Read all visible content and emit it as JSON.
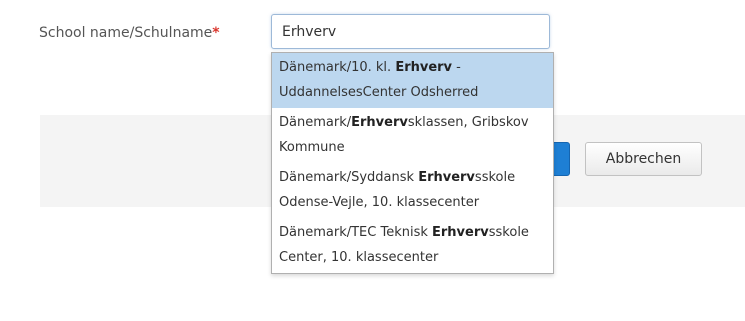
{
  "form": {
    "school_label": "School name/Schulname",
    "required_marker": "*",
    "school_input_value": "Erhverv"
  },
  "suggestions": [
    {
      "pre": "Dänemark/10. kl. ",
      "match": "Erhverv",
      "post": " - UddannelsesCenter Odsherred",
      "active": true
    },
    {
      "pre": "Dänemark/",
      "match": "Erhverv",
      "post": "sklassen, Gribskov Kommune",
      "active": false
    },
    {
      "pre": "Dänemark/Syddansk ",
      "match": "Erhverv",
      "post": "sskole Odense-Vejle, 10. klassecenter",
      "active": false
    },
    {
      "pre": "Dänemark/TEC Teknisk ",
      "match": "Erhverv",
      "post": "sskole Center, 10. klassecenter",
      "active": false
    }
  ],
  "buttons": {
    "cancel_label": "Abbrechen"
  },
  "colors": {
    "accent": "#1e7fd4",
    "highlight": "#bcd7ef",
    "required": "#d9342b"
  }
}
